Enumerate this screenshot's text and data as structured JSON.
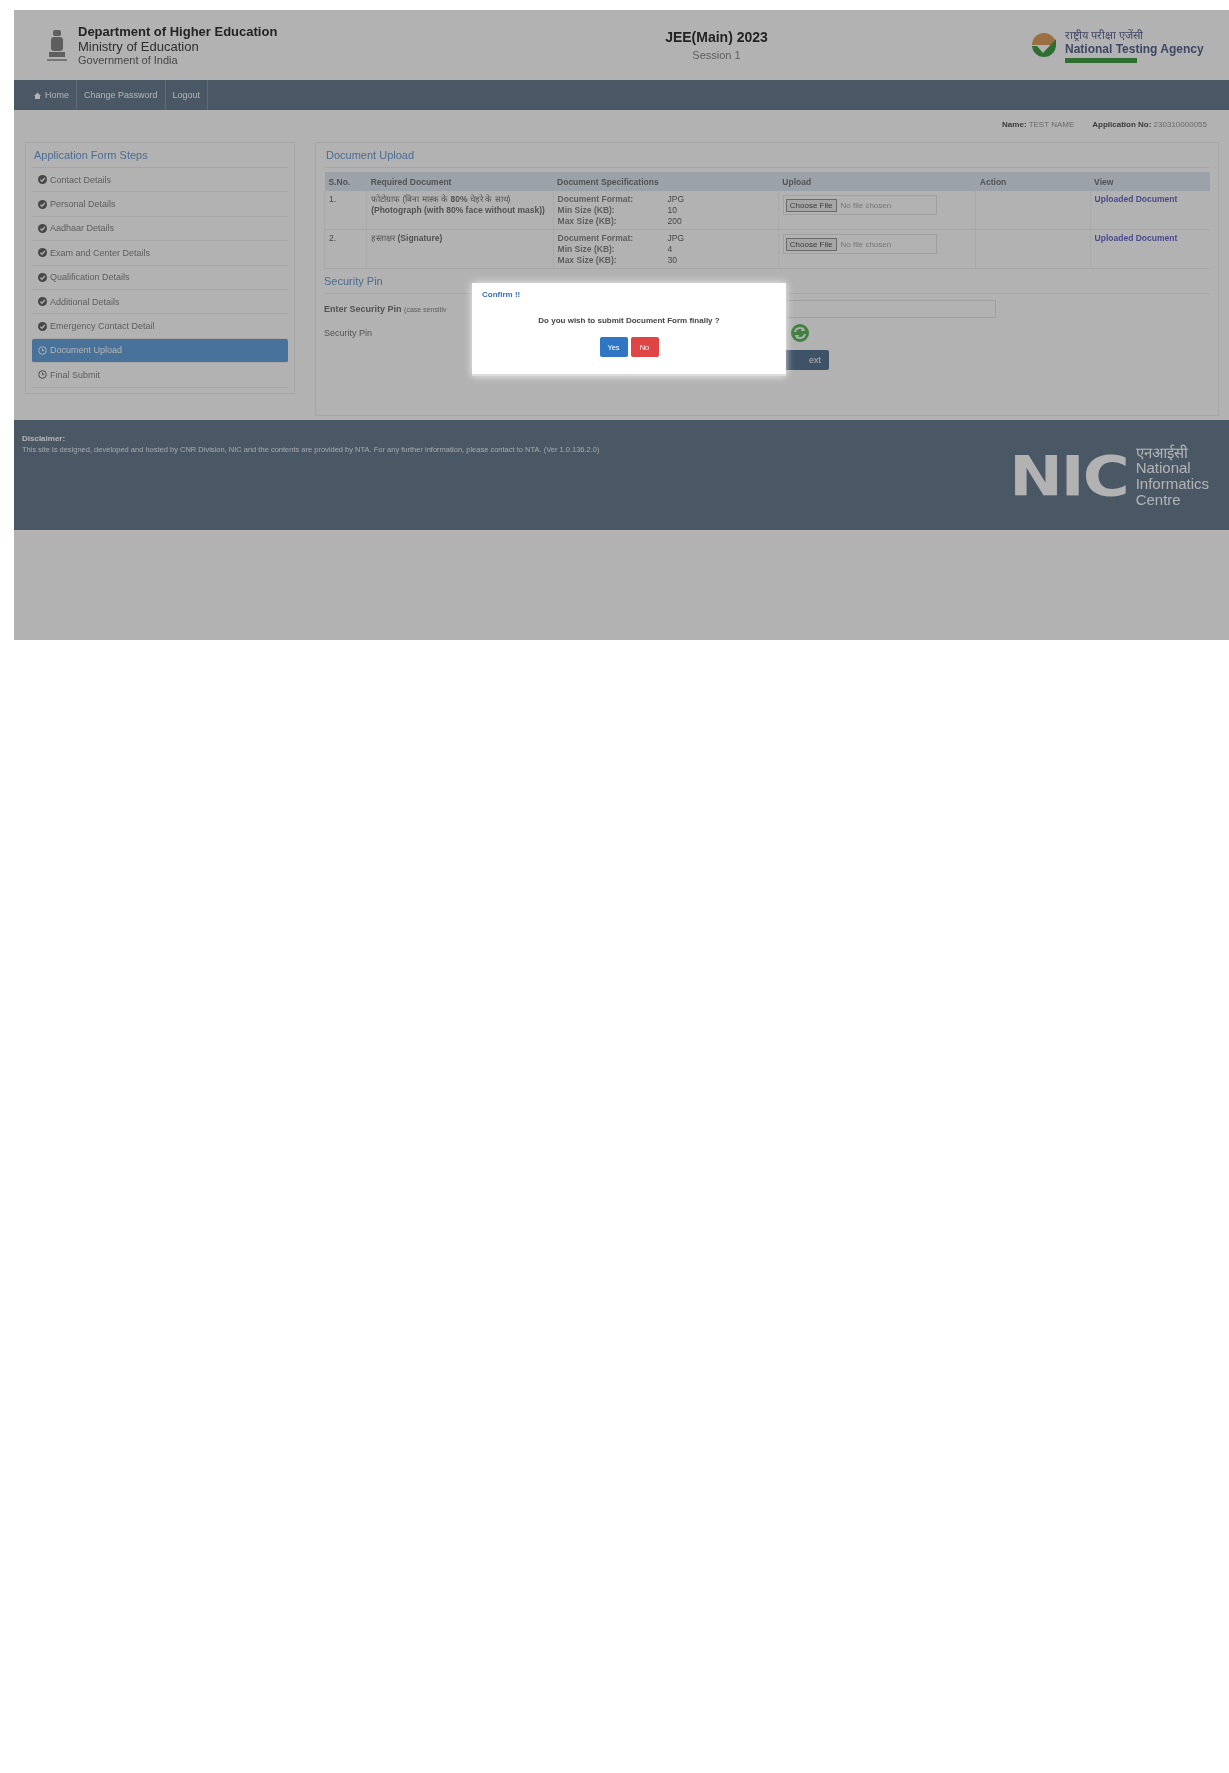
{
  "header": {
    "department": "Department of Higher Education",
    "ministry": "Ministry of Education",
    "government": "Government of India",
    "exam_title": "JEE(Main) 2023",
    "session": "Session 1",
    "agency_hindi": "राष्ट्रीय परीक्षा एजेंसी",
    "agency_name": "National Testing Agency"
  },
  "nav": [
    {
      "label": "Home",
      "kind": "home"
    },
    {
      "label": "Change Password",
      "kind": "link"
    },
    {
      "label": "Logout",
      "kind": "link"
    }
  ],
  "candidate": {
    "name_label": "Name:",
    "name": "TEST NAME",
    "application_label": "Application No:",
    "application_no": "230310000055"
  },
  "steps": {
    "title": "Application Form Steps",
    "items": [
      {
        "label": "Contact Details",
        "completed": true,
        "selected": false
      },
      {
        "label": "Personal Details",
        "completed": true,
        "selected": false
      },
      {
        "label": "Aadhaar Details",
        "completed": true,
        "selected": false
      },
      {
        "label": "Exam and Center Details",
        "completed": true,
        "selected": false
      },
      {
        "label": "Qualification Details",
        "completed": true,
        "selected": false
      },
      {
        "label": "Additional Details",
        "completed": true,
        "selected": false
      },
      {
        "label": "Emergency Contact Detail",
        "completed": true,
        "selected": false
      },
      {
        "label": "Document Upload",
        "completed": false,
        "selected": true
      },
      {
        "label": "Final Submit",
        "completed": false,
        "selected": false
      }
    ]
  },
  "document_upload": {
    "title": "Document Upload",
    "columns": [
      "S.No.",
      "Required Document",
      "Document Specifications",
      "Upload",
      "Action",
      "View"
    ],
    "rows": [
      {
        "sno": "1.",
        "document": "फोटोग्राफ (बिना मास्क के **80%** चेहरे के साथ) **(Photograph (with 80% face without mask))**",
        "specs": [
          {
            "label": "Document Format:",
            "value": "JPG"
          },
          {
            "label": "Min Size (KB):",
            "value": "10"
          },
          {
            "label": "Max Size (KB):",
            "value": "200"
          }
        ],
        "button": "Choose File",
        "file_status": "No file chosen",
        "view_link": "Uploaded Document"
      },
      {
        "sno": "2.",
        "document": "हस्ताक्षर **(Signature)**",
        "specs": [
          {
            "label": "Document Format:",
            "value": "JPG"
          },
          {
            "label": "Min Size (KB):",
            "value": "4"
          },
          {
            "label": "Max Size (KB):",
            "value": "30"
          }
        ],
        "button": "Choose File",
        "file_status": "No file chosen",
        "view_link": "Uploaded Document"
      }
    ]
  },
  "security_pin": {
    "title": "Security Pin",
    "enter_label": "Enter Security Pin",
    "hint": "(case sensitiv",
    "pin_label": "Security Pin",
    "next_button": "ext"
  },
  "footer": {
    "disclaimer_title": "Disclaimer:",
    "disclaimer_text": "This site is designed, developed and hosted by CNR Division, NIC and the contents are provided by NTA. For any further information, please contact to NTA. (Ver 1.0.136.2.0)",
    "nic_logo": "NIC",
    "nic_hindi": "एनआईसी",
    "nic_name": [
      "National",
      "Informatics",
      "Centre"
    ]
  },
  "dialog": {
    "title": "Confirm !!",
    "message": "Do you wish to submit Document Form finally ?",
    "buttons": [
      {
        "label": "Yes",
        "kind": "primary"
      },
      {
        "label": "No",
        "kind": "danger"
      }
    ]
  }
}
